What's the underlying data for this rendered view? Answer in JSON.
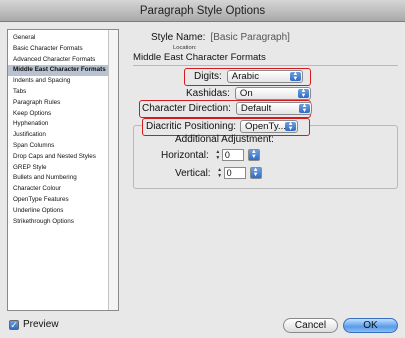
{
  "window": {
    "title": "Paragraph Style Options"
  },
  "sidebar": {
    "items": [
      {
        "label": "General"
      },
      {
        "label": "Basic Character Formats"
      },
      {
        "label": "Advanced Character Formats"
      },
      {
        "label": "Middle East Character Formats",
        "selected": true
      },
      {
        "label": "Indents and Spacing"
      },
      {
        "label": "Tabs"
      },
      {
        "label": "Paragraph Rules"
      },
      {
        "label": "Keep Options"
      },
      {
        "label": "Hyphenation"
      },
      {
        "label": "Justification"
      },
      {
        "label": "Span Columns"
      },
      {
        "label": "Drop Caps and Nested Styles"
      },
      {
        "label": "GREP Style"
      },
      {
        "label": "Bullets and Numbering"
      },
      {
        "label": "Character Colour"
      },
      {
        "label": "OpenType Features"
      },
      {
        "label": "Underline Options"
      },
      {
        "label": "Strikethrough Options"
      }
    ]
  },
  "main": {
    "style_name_label": "Style Name:",
    "style_name_value": "[Basic Paragraph]",
    "location_label": "Location:",
    "section_title": "Middle East Character Formats",
    "digits_label": "Digits:",
    "digits_value": "Arabic",
    "kashidas_label": "Kashidas:",
    "kashidas_value": "On",
    "char_direction_label": "Character Direction:",
    "char_direction_value": "Default",
    "diacritic_label": "Diacritic Positioning:",
    "diacritic_value": "OpenTy...",
    "additional_label": "Additional Adjustment:",
    "horizontal_label": "Horizontal:",
    "horizontal_value": "0",
    "vertical_label": "Vertical:",
    "vertical_value": "0"
  },
  "footer": {
    "preview_label": "Preview",
    "preview_checked": true,
    "cancel_label": "Cancel",
    "ok_label": "OK"
  },
  "colors": {
    "highlight": "#d41a1f",
    "accent": "#2f6cc4",
    "selected_row": "#b8c2d1"
  }
}
